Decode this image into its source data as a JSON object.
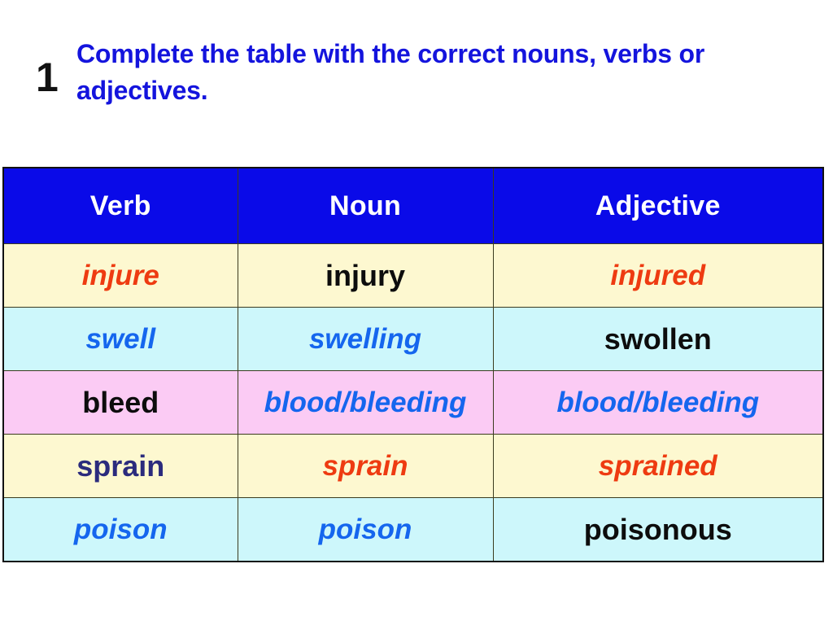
{
  "exercise": {
    "number": "1",
    "instruction": "Complete the table with the correct nouns, verbs or adjectives."
  },
  "table": {
    "headers": [
      "Verb",
      "Noun",
      "Adjective"
    ],
    "rows": [
      {
        "row_color": "#fdf8d0",
        "cells": [
          {
            "text": "injure",
            "color": "#ee3b11",
            "style": "italic"
          },
          {
            "text": "injury",
            "color": "#0d0d0d",
            "style": "normal"
          },
          {
            "text": "injured",
            "color": "#ee3b11",
            "style": "italic"
          }
        ]
      },
      {
        "row_color": "#cdf7fb",
        "cells": [
          {
            "text": "swell",
            "color": "#1566ee",
            "style": "italic"
          },
          {
            "text": "swelling",
            "color": "#1566ee",
            "style": "italic"
          },
          {
            "text": "swollen",
            "color": "#0d0d0d",
            "style": "normal"
          }
        ]
      },
      {
        "row_color": "#fbcbf4",
        "cells": [
          {
            "text": "bleed",
            "color": "#0d0d0d",
            "style": "normal"
          },
          {
            "text": "blood/bleeding",
            "color": "#1566ee",
            "style": "italic"
          },
          {
            "text": "blood/bleeding",
            "color": "#1566ee",
            "style": "italic"
          }
        ]
      },
      {
        "row_color": "#fdf8d0",
        "cells": [
          {
            "text": "sprain",
            "color": "#2b2b7d",
            "style": "normal"
          },
          {
            "text": "sprain",
            "color": "#ee3b11",
            "style": "italic"
          },
          {
            "text": "sprained",
            "color": "#ee3b11",
            "style": "italic"
          }
        ]
      },
      {
        "row_color": "#cdf7fb",
        "cells": [
          {
            "text": "poison",
            "color": "#1566ee",
            "style": "italic"
          },
          {
            "text": "poison",
            "color": "#1566ee",
            "style": "italic"
          },
          {
            "text": "poisonous",
            "color": "#0d0d0d",
            "style": "normal"
          }
        ]
      }
    ]
  },
  "colors": {
    "header_background": "#0a0ae8",
    "header_text": "#ffffff",
    "instruction_text": "#1414dd",
    "number_text": "#111111",
    "border": "#111111",
    "page_background": "#ffffff"
  }
}
